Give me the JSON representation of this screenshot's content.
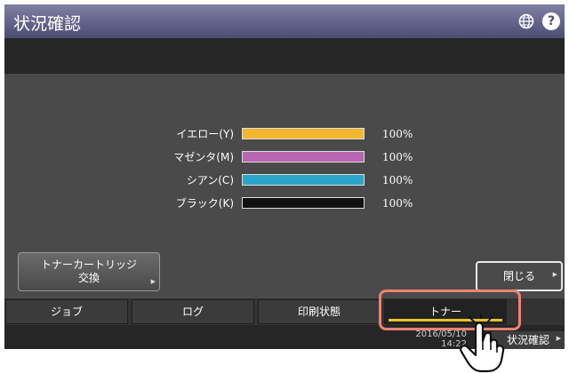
{
  "header": {
    "title": "状況確認",
    "globe_icon": "globe-icon",
    "help_label": "?"
  },
  "toner": {
    "items": [
      {
        "label": "イエロー(Y)",
        "percent": "100%",
        "level": 1.0,
        "color": "#f2b72e"
      },
      {
        "label": "マゼンタ(M)",
        "percent": "100%",
        "level": 1.0,
        "color": "#b766b1"
      },
      {
        "label": "シアン(C)",
        "percent": "100%",
        "level": 1.0,
        "color": "#2aa6c9"
      },
      {
        "label": "ブラック(K)",
        "percent": "100%",
        "level": 1.0,
        "color": "#111111"
      }
    ]
  },
  "buttons": {
    "cartridge_line1": "トナーカートリッジ",
    "cartridge_line2": "交換",
    "close": "閉じる"
  },
  "tabs": [
    {
      "label": "ジョブ"
    },
    {
      "label": "ログ"
    },
    {
      "label": "印刷状態"
    },
    {
      "label": "トナー",
      "active": true
    }
  ],
  "footer": {
    "date": "2016/05/10",
    "time": "14:22",
    "status_button": "状況確認"
  },
  "colors": {
    "title_bar": "#5c5c86",
    "tab_active_underline": "#e6c229",
    "highlight": "#ef8271"
  }
}
